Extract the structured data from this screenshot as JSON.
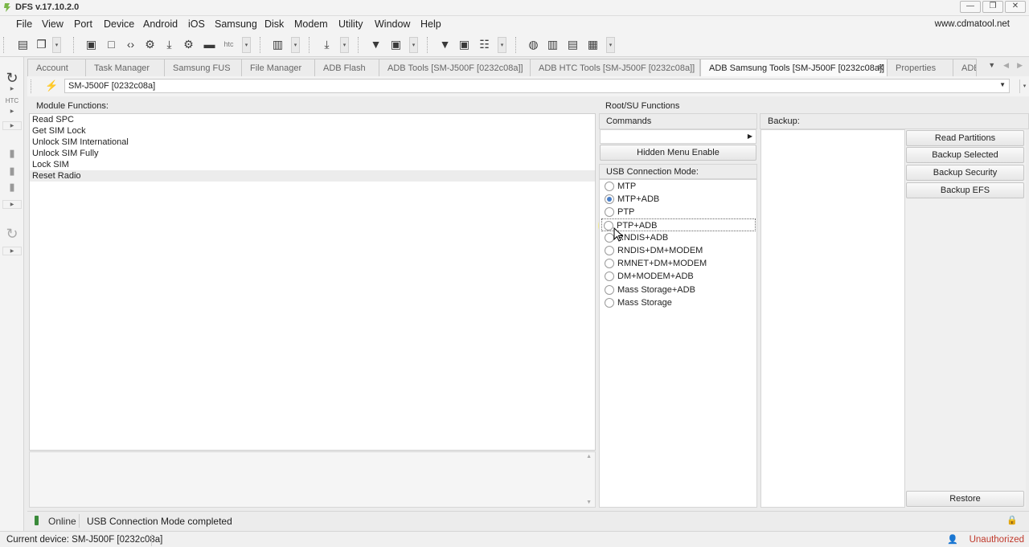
{
  "window": {
    "title": "DFS v.17.10.2.0",
    "min": "—",
    "restore": "❐",
    "close": "✕"
  },
  "menu": [
    "File",
    "View",
    "Port",
    "Device",
    "Android",
    "iOS",
    "Samsung",
    "Disk",
    "Modem",
    "Utility",
    "Window",
    "Help"
  ],
  "website": "www.cdmatool.net",
  "toolbar": {
    "htc_label": "htc"
  },
  "left_strip": {
    "htc_label": "HTC"
  },
  "tabs": [
    "Account",
    "Task Manager",
    "Samsung FUS",
    "File Manager",
    "ADB Flash",
    "ADB Tools [SM-J500F [0232c08a]]",
    "ADB HTC Tools [SM-J500F [0232c08a]]",
    "ADB Samsung Tools [SM-J500F [0232c08a]]",
    "Properties",
    "ADB"
  ],
  "tab_close": "✕",
  "device": {
    "selected": "SM-J500F [0232c08a]"
  },
  "module": {
    "header": "Module Functions:",
    "items": [
      "Read SPC",
      "Get SIM Lock",
      "Unlock SIM International",
      "Unlock SIM Fully",
      "Lock SIM",
      "Reset Radio"
    ]
  },
  "root": {
    "header": "Root/SU Functions"
  },
  "commands": {
    "header": "Commands",
    "hidden_menu_button": "Hidden Menu Enable"
  },
  "usb": {
    "header": "USB Connection Mode:",
    "options": [
      "MTP",
      "MTP+ADB",
      "PTP",
      "PTP+ADB",
      "RNDIS+ADB",
      "RNDIS+DM+MODEM",
      "RMNET+DM+MODEM",
      "DM+MODEM+ADB",
      "Mass Storage+ADB",
      "Mass Storage"
    ],
    "selected": "MTP+ADB"
  },
  "backup": {
    "header": "Backup:",
    "buttons": [
      "Read Partitions",
      "Backup Selected",
      "Backup Security",
      "Backup EFS"
    ],
    "restore": "Restore"
  },
  "status": {
    "online": "Online",
    "message": "USB Connection Mode completed"
  },
  "bottom": {
    "current_device": "Current device: SM-J500F [0232c08a]",
    "auth": "Unauthorized"
  },
  "colors": {
    "accent": "#4a7fc8",
    "unauthorized": "#c0392b",
    "online": "#3a8a3a"
  }
}
